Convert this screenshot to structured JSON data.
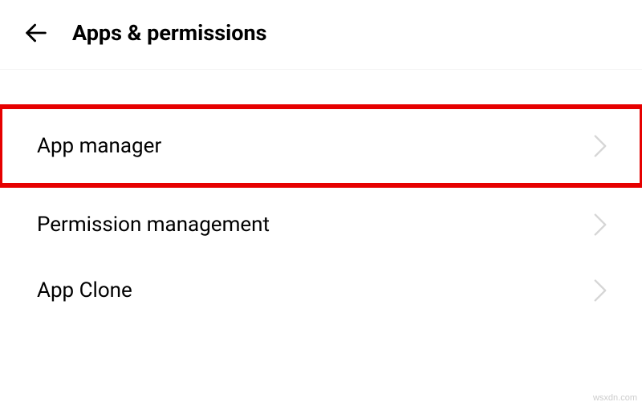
{
  "header": {
    "title": "Apps & permissions"
  },
  "list": {
    "items": [
      {
        "label": "App manager",
        "highlighted": true
      },
      {
        "label": "Permission management",
        "highlighted": false
      },
      {
        "label": "App Clone",
        "highlighted": false
      }
    ]
  },
  "watermark": "wsxdn.com"
}
